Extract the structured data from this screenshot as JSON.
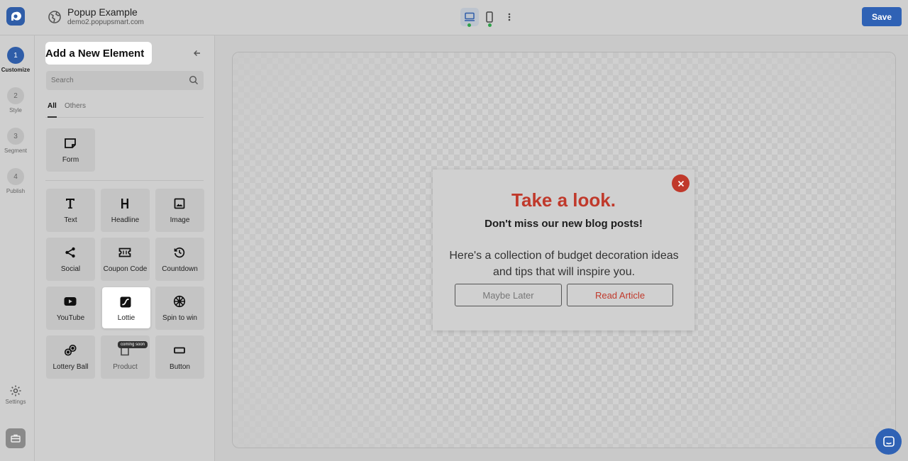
{
  "header": {
    "site_title": "Popup Example",
    "site_url": "demo2.popupsmart.com",
    "save_label": "Save"
  },
  "steps": [
    {
      "num": "1",
      "label": "Customize",
      "active": true
    },
    {
      "num": "2",
      "label": "Style"
    },
    {
      "num": "3",
      "label": "Segment"
    },
    {
      "num": "4",
      "label": "Publish"
    }
  ],
  "rail": {
    "settings_label": "Settings"
  },
  "panel": {
    "title": "Add a New Element",
    "search_placeholder": "Search",
    "tabs": [
      "All",
      "Others"
    ],
    "active_tab": "All",
    "form_element": {
      "label": "Form",
      "icon": "form-icon"
    },
    "elements": [
      {
        "label": "Text",
        "icon": "text-icon"
      },
      {
        "label": "Headline",
        "icon": "headline-icon"
      },
      {
        "label": "Image",
        "icon": "image-icon"
      },
      {
        "label": "Social",
        "icon": "share-icon"
      },
      {
        "label": "Coupon Code",
        "icon": "coupon-icon"
      },
      {
        "label": "Countdown",
        "icon": "history-icon"
      },
      {
        "label": "YouTube",
        "icon": "youtube-icon"
      },
      {
        "label": "Lottie",
        "icon": "lottie-icon",
        "selected": true
      },
      {
        "label": "Spin to win",
        "icon": "wheel-icon"
      },
      {
        "label": "Lottery Ball",
        "icon": "lottery-ball-icon"
      },
      {
        "label": "Product",
        "icon": "product-icon",
        "tooltip": "coming soon"
      },
      {
        "label": "Button",
        "icon": "button-icon"
      }
    ]
  },
  "popup": {
    "heading": "Take a look.",
    "subheading": "Don't miss our new blog posts!",
    "body": "Here's a collection of budget decoration ideas and tips that will inspire you.",
    "secondary_button": "Maybe Later",
    "primary_button": "Read Article",
    "accent_color": "#c0392b"
  },
  "colors": {
    "brand": "#2f5da8",
    "save_button": "#2f62b5"
  }
}
